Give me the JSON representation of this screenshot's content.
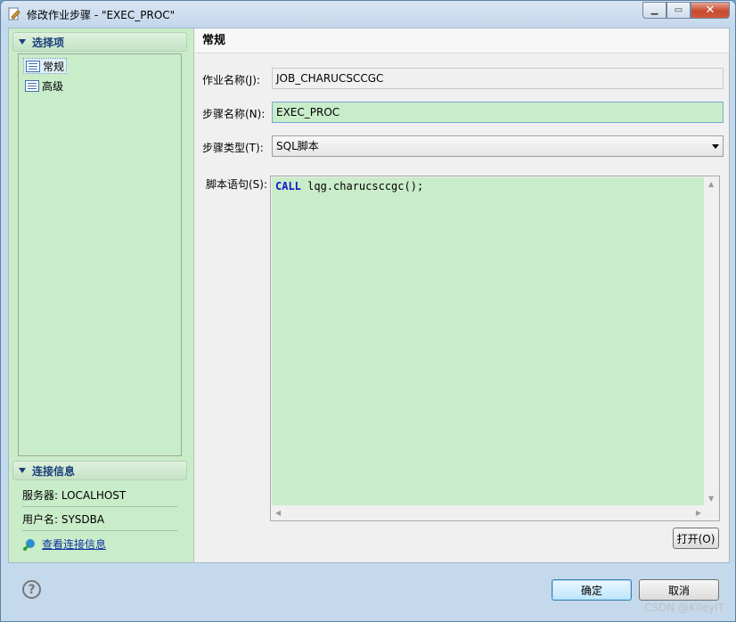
{
  "window": {
    "title": "修改作业步骤 - \"EXEC_PROC\"",
    "minimize_glyph": "▁",
    "maximize_glyph": "▭",
    "close_glyph": "✕"
  },
  "sidebar": {
    "options_header": "选择项",
    "tree_items": [
      {
        "label": "常规",
        "selected": true
      },
      {
        "label": "高级",
        "selected": false
      }
    ],
    "connection_header": "连接信息",
    "server": "服务器: LOCALHOST",
    "user": "用户名: SYSDBA",
    "view_connection_link": "查看连接信息"
  },
  "main": {
    "page_title": "常规",
    "job_name_label": "作业名称(J):",
    "job_name_value": "JOB_CHARUCSCCGC",
    "step_name_label": "步骤名称(N):",
    "step_name_value": "EXEC_PROC",
    "step_type_label": "步骤类型(T):",
    "step_type_value": "SQL脚本",
    "script_label": "脚本语句(S):",
    "script_keyword": "CALL",
    "script_rest": " lqg.charucsccgc();",
    "open_button": "打开(O)"
  },
  "footer": {
    "help_glyph": "?",
    "ok_button": "确定",
    "cancel_button": "取消",
    "watermark": "CSDN @KileyIT"
  },
  "colors": {
    "editable_bg": "#c9ecc9",
    "keyword": "#1515c8",
    "link": "#1030a0"
  }
}
